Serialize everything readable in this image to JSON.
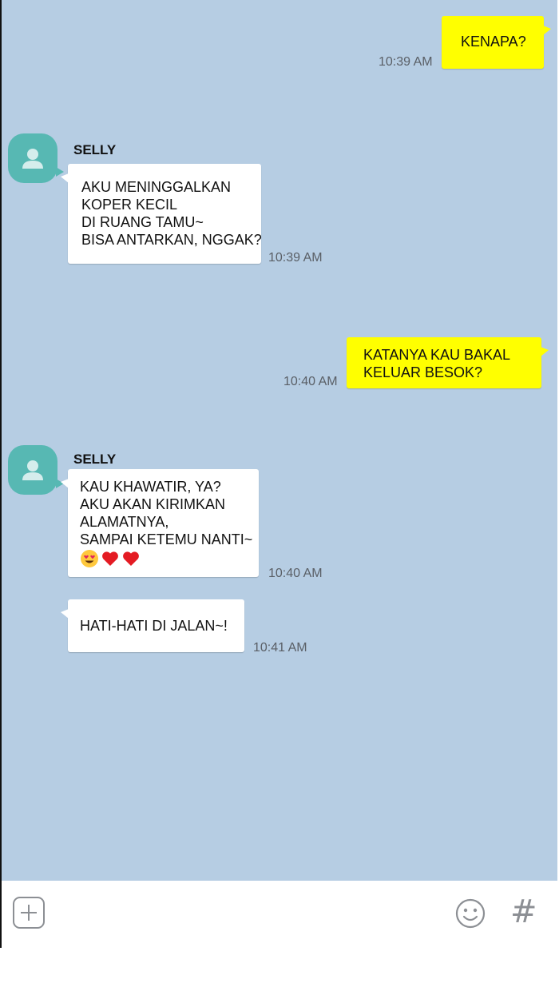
{
  "contact": {
    "name": "SELLY"
  },
  "messages": [
    {
      "direction": "out",
      "lines": [
        "KENAPA?"
      ],
      "time": "10:39 AM"
    },
    {
      "direction": "in",
      "sender": "SELLY",
      "lines": [
        "AKU MENINGGALKAN",
        "KOPER KECIL",
        "DI RUANG TAMU~",
        "BISA ANTARKAN, NGGAK?"
      ],
      "time": "10:39 AM"
    },
    {
      "direction": "out",
      "lines": [
        "KATANYA KAU BAKAL",
        "KELUAR BESOK?"
      ],
      "time": "10:40 AM"
    },
    {
      "direction": "in",
      "sender": "SELLY",
      "lines": [
        "KAU KHAWATIR, YA?",
        "AKU AKAN KIRIMKAN",
        "ALAMATNYA,",
        "SAMPAI KETEMU NANTI~"
      ],
      "emojis": [
        "heart-eyes-emoji",
        "red-heart-emoji",
        "red-heart-emoji"
      ],
      "time": "10:40 AM"
    },
    {
      "direction": "in",
      "lines": [
        "HATI-HATI DI JALAN~!"
      ],
      "time": "10:41 AM"
    }
  ],
  "input_bar": {
    "icons": [
      "plus-square-icon",
      "smiley-icon",
      "hash-icon"
    ],
    "hash_symbol": "#"
  },
  "colors": {
    "chat_background": "#b6cde3",
    "outgoing_bubble": "#ffff00",
    "incoming_bubble": "#ffffff",
    "avatar": "#57b8b3"
  }
}
